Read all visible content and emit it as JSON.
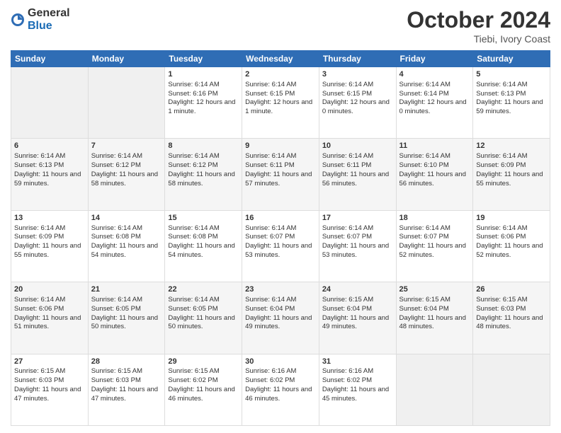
{
  "header": {
    "logo_general": "General",
    "logo_blue": "Blue",
    "title": "October 2024",
    "location": "Tiebi, Ivory Coast"
  },
  "days_of_week": [
    "Sunday",
    "Monday",
    "Tuesday",
    "Wednesday",
    "Thursday",
    "Friday",
    "Saturday"
  ],
  "weeks": [
    [
      {
        "day": "",
        "sunrise": "",
        "sunset": "",
        "daylight": ""
      },
      {
        "day": "",
        "sunrise": "",
        "sunset": "",
        "daylight": ""
      },
      {
        "day": "1",
        "sunrise": "Sunrise: 6:14 AM",
        "sunset": "Sunset: 6:16 PM",
        "daylight": "Daylight: 12 hours and 1 minute."
      },
      {
        "day": "2",
        "sunrise": "Sunrise: 6:14 AM",
        "sunset": "Sunset: 6:15 PM",
        "daylight": "Daylight: 12 hours and 1 minute."
      },
      {
        "day": "3",
        "sunrise": "Sunrise: 6:14 AM",
        "sunset": "Sunset: 6:15 PM",
        "daylight": "Daylight: 12 hours and 0 minutes."
      },
      {
        "day": "4",
        "sunrise": "Sunrise: 6:14 AM",
        "sunset": "Sunset: 6:14 PM",
        "daylight": "Daylight: 12 hours and 0 minutes."
      },
      {
        "day": "5",
        "sunrise": "Sunrise: 6:14 AM",
        "sunset": "Sunset: 6:13 PM",
        "daylight": "Daylight: 11 hours and 59 minutes."
      }
    ],
    [
      {
        "day": "6",
        "sunrise": "Sunrise: 6:14 AM",
        "sunset": "Sunset: 6:13 PM",
        "daylight": "Daylight: 11 hours and 59 minutes."
      },
      {
        "day": "7",
        "sunrise": "Sunrise: 6:14 AM",
        "sunset": "Sunset: 6:12 PM",
        "daylight": "Daylight: 11 hours and 58 minutes."
      },
      {
        "day": "8",
        "sunrise": "Sunrise: 6:14 AM",
        "sunset": "Sunset: 6:12 PM",
        "daylight": "Daylight: 11 hours and 58 minutes."
      },
      {
        "day": "9",
        "sunrise": "Sunrise: 6:14 AM",
        "sunset": "Sunset: 6:11 PM",
        "daylight": "Daylight: 11 hours and 57 minutes."
      },
      {
        "day": "10",
        "sunrise": "Sunrise: 6:14 AM",
        "sunset": "Sunset: 6:11 PM",
        "daylight": "Daylight: 11 hours and 56 minutes."
      },
      {
        "day": "11",
        "sunrise": "Sunrise: 6:14 AM",
        "sunset": "Sunset: 6:10 PM",
        "daylight": "Daylight: 11 hours and 56 minutes."
      },
      {
        "day": "12",
        "sunrise": "Sunrise: 6:14 AM",
        "sunset": "Sunset: 6:09 PM",
        "daylight": "Daylight: 11 hours and 55 minutes."
      }
    ],
    [
      {
        "day": "13",
        "sunrise": "Sunrise: 6:14 AM",
        "sunset": "Sunset: 6:09 PM",
        "daylight": "Daylight: 11 hours and 55 minutes."
      },
      {
        "day": "14",
        "sunrise": "Sunrise: 6:14 AM",
        "sunset": "Sunset: 6:08 PM",
        "daylight": "Daylight: 11 hours and 54 minutes."
      },
      {
        "day": "15",
        "sunrise": "Sunrise: 6:14 AM",
        "sunset": "Sunset: 6:08 PM",
        "daylight": "Daylight: 11 hours and 54 minutes."
      },
      {
        "day": "16",
        "sunrise": "Sunrise: 6:14 AM",
        "sunset": "Sunset: 6:07 PM",
        "daylight": "Daylight: 11 hours and 53 minutes."
      },
      {
        "day": "17",
        "sunrise": "Sunrise: 6:14 AM",
        "sunset": "Sunset: 6:07 PM",
        "daylight": "Daylight: 11 hours and 53 minutes."
      },
      {
        "day": "18",
        "sunrise": "Sunrise: 6:14 AM",
        "sunset": "Sunset: 6:07 PM",
        "daylight": "Daylight: 11 hours and 52 minutes."
      },
      {
        "day": "19",
        "sunrise": "Sunrise: 6:14 AM",
        "sunset": "Sunset: 6:06 PM",
        "daylight": "Daylight: 11 hours and 52 minutes."
      }
    ],
    [
      {
        "day": "20",
        "sunrise": "Sunrise: 6:14 AM",
        "sunset": "Sunset: 6:06 PM",
        "daylight": "Daylight: 11 hours and 51 minutes."
      },
      {
        "day": "21",
        "sunrise": "Sunrise: 6:14 AM",
        "sunset": "Sunset: 6:05 PM",
        "daylight": "Daylight: 11 hours and 50 minutes."
      },
      {
        "day": "22",
        "sunrise": "Sunrise: 6:14 AM",
        "sunset": "Sunset: 6:05 PM",
        "daylight": "Daylight: 11 hours and 50 minutes."
      },
      {
        "day": "23",
        "sunrise": "Sunrise: 6:14 AM",
        "sunset": "Sunset: 6:04 PM",
        "daylight": "Daylight: 11 hours and 49 minutes."
      },
      {
        "day": "24",
        "sunrise": "Sunrise: 6:15 AM",
        "sunset": "Sunset: 6:04 PM",
        "daylight": "Daylight: 11 hours and 49 minutes."
      },
      {
        "day": "25",
        "sunrise": "Sunrise: 6:15 AM",
        "sunset": "Sunset: 6:04 PM",
        "daylight": "Daylight: 11 hours and 48 minutes."
      },
      {
        "day": "26",
        "sunrise": "Sunrise: 6:15 AM",
        "sunset": "Sunset: 6:03 PM",
        "daylight": "Daylight: 11 hours and 48 minutes."
      }
    ],
    [
      {
        "day": "27",
        "sunrise": "Sunrise: 6:15 AM",
        "sunset": "Sunset: 6:03 PM",
        "daylight": "Daylight: 11 hours and 47 minutes."
      },
      {
        "day": "28",
        "sunrise": "Sunrise: 6:15 AM",
        "sunset": "Sunset: 6:03 PM",
        "daylight": "Daylight: 11 hours and 47 minutes."
      },
      {
        "day": "29",
        "sunrise": "Sunrise: 6:15 AM",
        "sunset": "Sunset: 6:02 PM",
        "daylight": "Daylight: 11 hours and 46 minutes."
      },
      {
        "day": "30",
        "sunrise": "Sunrise: 6:16 AM",
        "sunset": "Sunset: 6:02 PM",
        "daylight": "Daylight: 11 hours and 46 minutes."
      },
      {
        "day": "31",
        "sunrise": "Sunrise: 6:16 AM",
        "sunset": "Sunset: 6:02 PM",
        "daylight": "Daylight: 11 hours and 45 minutes."
      },
      {
        "day": "",
        "sunrise": "",
        "sunset": "",
        "daylight": ""
      },
      {
        "day": "",
        "sunrise": "",
        "sunset": "",
        "daylight": ""
      }
    ]
  ]
}
